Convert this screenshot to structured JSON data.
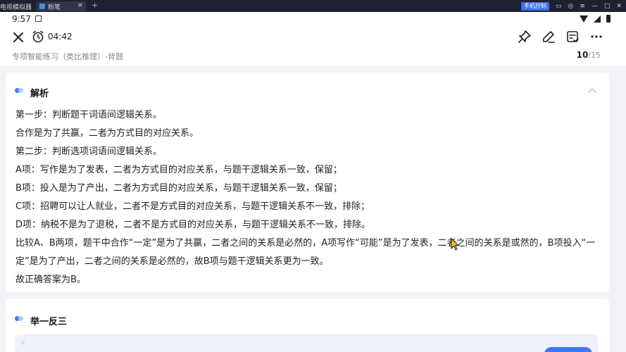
{
  "host": {
    "app_title": "电视模拟器",
    "tab_label": "粉笔",
    "tab_close": "×",
    "add_tab": "+",
    "badge": "手机控制"
  },
  "status": {
    "time": "9:57"
  },
  "header": {
    "timer": "04:42",
    "subtitle": "专项智能练习（类比推理）-背题",
    "progress_current": "10",
    "progress_total": "/15"
  },
  "analysis": {
    "title": "解析",
    "lines": [
      "第一步：判断题干词语间逻辑关系。",
      "合作是为了共赢，二者为方式目的对应关系。",
      "第二步：判断选项词语间逻辑关系。",
      "A项：写作是为了发表，二者为方式目的对应关系，与题干逻辑关系一致，保留；",
      "B项：投入是为了产出，二者为方式目的对应关系，与题干逻辑关系一致，保留；",
      "C项：招聘可以让人就业，二者不是方式目的对应关系，与题干逻辑关系不一致，排除；",
      "D项：纳税不是为了退税，二者不是方式目的对应关系，与题干逻辑关系不一致，排除。",
      "比较A、B两项，题干中合作“一定”是为了共赢，二者之间的关系是必然的，A项写作“可能”是为了发表，二者之间的关系是或然的，B项投入“一定”是为了产出，二者之间的关系是必然的，故B项与题干逻辑关系更为一致。",
      "故正确答案为B。"
    ]
  },
  "section2": {
    "title": "举一反三"
  },
  "colors": {
    "accent": "#3d7af5",
    "dot_primary": "#3d7af5",
    "dot_secondary": "#a9c3f7"
  }
}
